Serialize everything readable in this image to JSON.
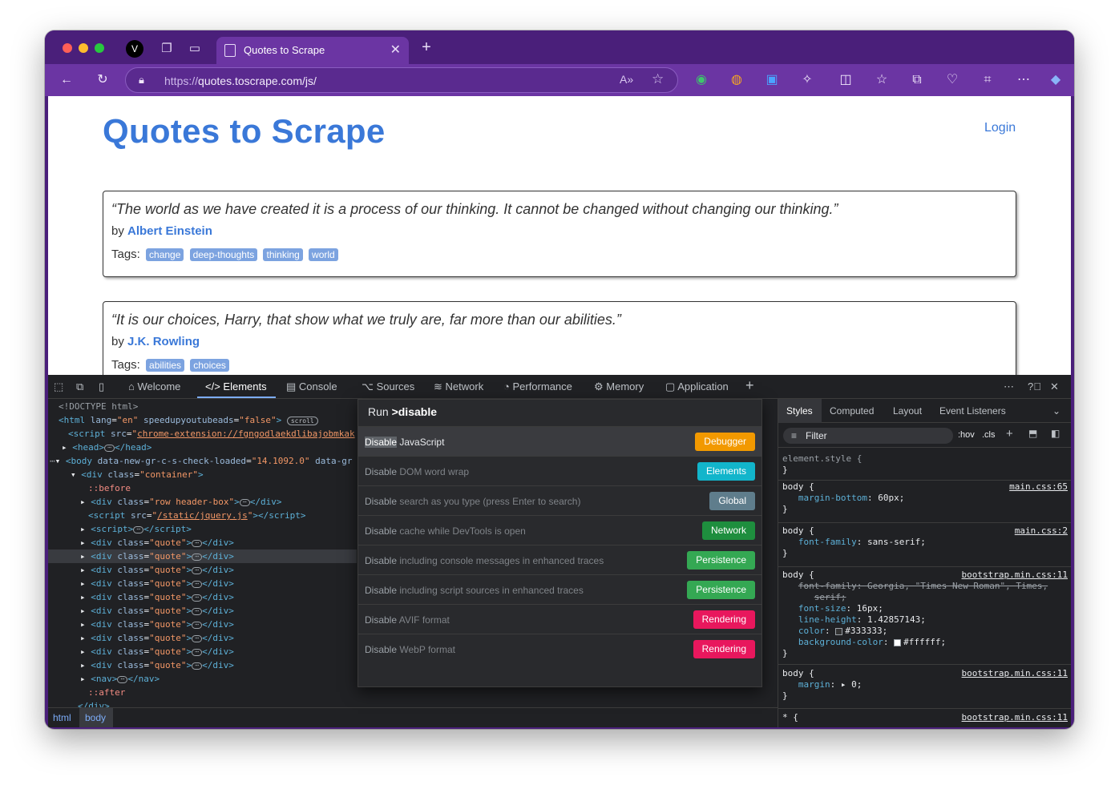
{
  "browser": {
    "tab_title": "Quotes to Scrape",
    "url_prefix": "https://",
    "url_host": "quotes.toscrape.com",
    "url_path": "/js/"
  },
  "page": {
    "title": "Quotes to Scrape",
    "login": "Login",
    "tags_label": "Tags:",
    "by_label": "by",
    "quotes": [
      {
        "text": "“The world as we have created it is a process of our thinking. It cannot be changed without changing our thinking.”",
        "author": "Albert Einstein",
        "tags": [
          "change",
          "deep-thoughts",
          "thinking",
          "world"
        ]
      },
      {
        "text": "“It is our choices, Harry, that show what we truly are, far more than our abilities.”",
        "author": "J.K. Rowling",
        "tags": [
          "abilities",
          "choices"
        ]
      }
    ]
  },
  "devtools": {
    "tabs": [
      "Welcome",
      "Elements",
      "Console",
      "Sources",
      "Network",
      "Performance",
      "Memory",
      "Application"
    ],
    "dom": {
      "doctype": "<!DOCTYPE html>",
      "html_lang": "en",
      "html_attr": "speedupyoutubeads",
      "html_attr_val": "false",
      "scroll_pill": "scroll",
      "ext_src": "chrome-extension://fgngodlaekdlibajobmkak",
      "body_attr": "data-new-gr-c-s-check-loaded",
      "body_attr_val": "14.1092.0",
      "body_attr2": "data-gr",
      "container_class": "container",
      "before": "::before",
      "header_class": "row header-box",
      "jquery_src": "/static/jquery.js",
      "quote_class": "quote",
      "after": "::after"
    },
    "breadcrumbs": [
      "html",
      "body"
    ],
    "palette": {
      "run_label": "Run",
      "query": ">disable",
      "items": [
        {
          "keyword": "Disable",
          "rest": "JavaScript",
          "badge": "Debugger",
          "color": "#f29900"
        },
        {
          "keyword": "Disable",
          "rest": "DOM word wrap",
          "badge": "Elements",
          "color": "#12b5cb"
        },
        {
          "keyword": "Disable",
          "rest": "search as you type (press Enter to search)",
          "badge": "Global",
          "color": "#5f7d8c"
        },
        {
          "keyword": "Disable",
          "rest": "cache while DevTools is open",
          "badge": "Network",
          "color": "#1e8e3e"
        },
        {
          "keyword": "Disable",
          "rest": "including console messages in enhanced traces",
          "badge": "Persistence",
          "color": "#34a853"
        },
        {
          "keyword": "Disable",
          "rest": "including script sources in enhanced traces",
          "badge": "Persistence",
          "color": "#34a853"
        },
        {
          "keyword": "Disable",
          "rest": "AVIF format",
          "badge": "Rendering",
          "color": "#e8175d"
        },
        {
          "keyword": "Disable",
          "rest": "WebP format",
          "badge": "Rendering",
          "color": "#e8175d"
        }
      ]
    },
    "styles": {
      "tabs": [
        "Styles",
        "Computed",
        "Layout",
        "Event Listeners"
      ],
      "filter": "Filter",
      "hov": ":hov",
      "cls": ".cls",
      "element_style": "element.style {",
      "rules": [
        {
          "selector": "body {",
          "source": "main.css:65",
          "props": [
            {
              "name": "margin-bottom",
              "value": "60px;"
            }
          ]
        },
        {
          "selector": "body {",
          "source": "main.css:2",
          "props": [
            {
              "name": "font-family",
              "value": "sans-serif;"
            }
          ]
        },
        {
          "selector": "body {",
          "source": "bootstrap.min.css:11",
          "props": [
            {
              "name": "font-family",
              "value": "Georgia, \"Times New Roman\", Times,"
            },
            {
              "name": "",
              "value": "serif;"
            },
            {
              "name": "font-size",
              "value": "16px;"
            },
            {
              "name": "line-height",
              "value": "1.42857143;"
            },
            {
              "name": "color",
              "value": "#333333;"
            },
            {
              "name": "background-color",
              "value": "#ffffff;"
            }
          ]
        },
        {
          "selector": "body {",
          "source": "bootstrap.min.css:11",
          "props": [
            {
              "name": "margin",
              "value": "0;"
            }
          ]
        },
        {
          "selector": "* {",
          "source": "bootstrap.min.css:11",
          "props": []
        }
      ],
      "close_brace": "}"
    }
  }
}
